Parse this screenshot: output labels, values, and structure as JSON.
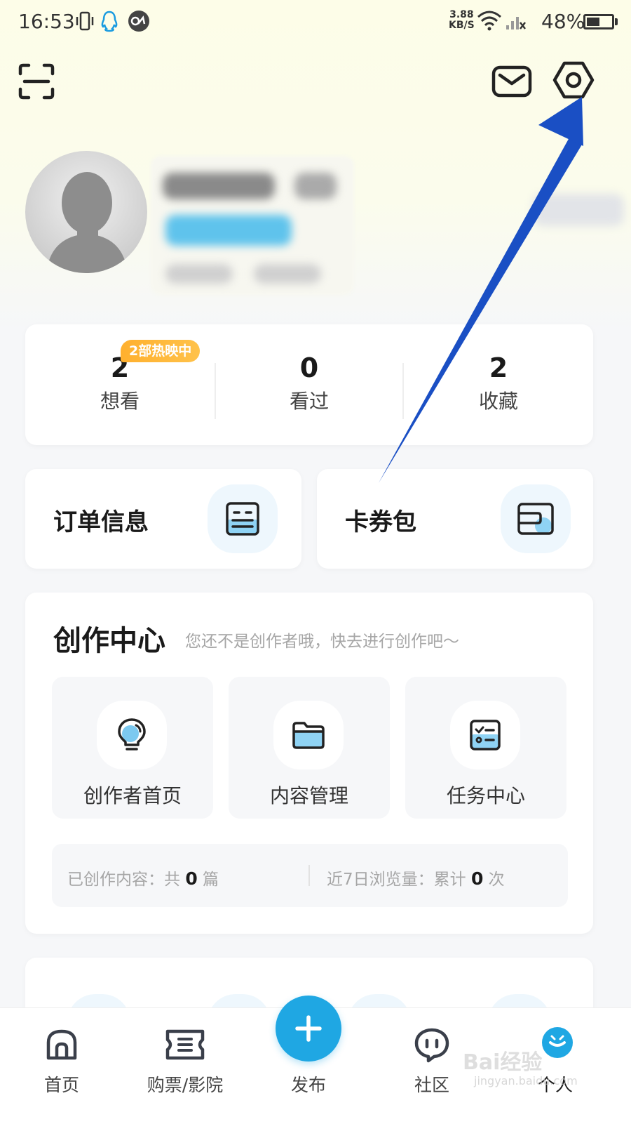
{
  "status_bar": {
    "time": "16:53",
    "net_speed_value": "3.88",
    "net_speed_unit": "KB/S",
    "battery": "48%"
  },
  "header": {
    "scan_icon": "scan-icon",
    "message_icon": "mail-icon",
    "settings_icon": "settings-hexagon-icon"
  },
  "stats": {
    "badge": "2部热映中",
    "items": [
      {
        "value": "2",
        "label": "想看"
      },
      {
        "value": "0",
        "label": "看过"
      },
      {
        "value": "2",
        "label": "收藏"
      }
    ]
  },
  "quick": {
    "orders": "订单信息",
    "coupons": "卡券包"
  },
  "creator": {
    "title": "创作中心",
    "subtitle": "您还不是创作者哦，快去进行创作吧～",
    "tiles": [
      {
        "label": "创作者首页",
        "icon": "lightbulb-icon"
      },
      {
        "label": "内容管理",
        "icon": "folder-icon"
      },
      {
        "label": "任务中心",
        "icon": "checklist-icon"
      }
    ],
    "created_prefix": "已创作内容：共",
    "created_count": "0",
    "created_suffix": "篇",
    "views_prefix": "近7日浏览量：累计",
    "views_count": "0",
    "views_suffix": "次"
  },
  "bottom_nav": {
    "items": [
      {
        "label": "首页",
        "icon": "home-icon"
      },
      {
        "label": "购票/影院",
        "icon": "ticket-icon"
      },
      {
        "label": "发布",
        "icon": "plus-icon"
      },
      {
        "label": "社区",
        "icon": "chat-icon"
      },
      {
        "label": "个人",
        "icon": "profile-icon"
      }
    ]
  },
  "watermark": {
    "text": "Bai经验",
    "sub": "jingyan.baidu.com"
  },
  "colors": {
    "accent": "#1fa7e3",
    "badge": "#ffb02e",
    "arrow": "#1a4fc4"
  }
}
